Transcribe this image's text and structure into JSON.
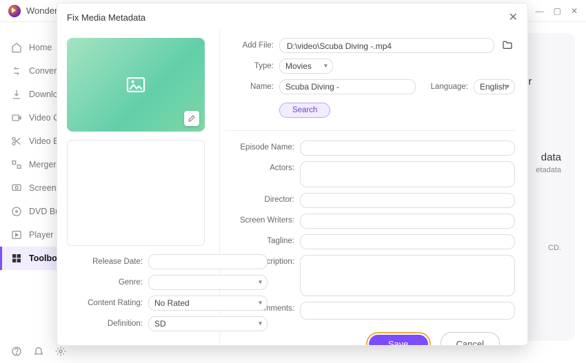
{
  "app": {
    "brand_partial": "Wonder"
  },
  "sidebar": {
    "items": [
      {
        "label": "Home"
      },
      {
        "label": "Convert"
      },
      {
        "label": "Downloa"
      },
      {
        "label": "Video C"
      },
      {
        "label": "Video Ed"
      },
      {
        "label": "Merger"
      },
      {
        "label": "Screen R"
      },
      {
        "label": "DVD Bu"
      },
      {
        "label": "Player"
      },
      {
        "label": "Toolbox"
      }
    ]
  },
  "peek": {
    "card1_line1": "tor",
    "card2_line1": "data",
    "card2_line2": "etadata",
    "card3_line1": "CD."
  },
  "modal": {
    "title": "Fix Media Metadata",
    "labels": {
      "add_file": "Add File:",
      "type": "Type:",
      "name": "Name:",
      "language": "Language:",
      "search": "Search",
      "episode_name": "Episode Name:",
      "actors": "Actors:",
      "director": "Director:",
      "screen_writers": "Screen Writers:",
      "tagline": "Tagline:",
      "description": "Description:",
      "comments": "Comments:",
      "release_date": "Release Date:",
      "genre": "Genre:",
      "content_rating": "Content Rating:",
      "definition": "Definition:"
    },
    "values": {
      "file_path": "D:\\video\\Scuba Diving -.mp4",
      "type": "Movies",
      "name": "Scuba Diving -",
      "language": "English",
      "content_rating": "No Rated",
      "definition": "SD"
    },
    "buttons": {
      "save": "Save",
      "cancel": "Cancel"
    }
  }
}
